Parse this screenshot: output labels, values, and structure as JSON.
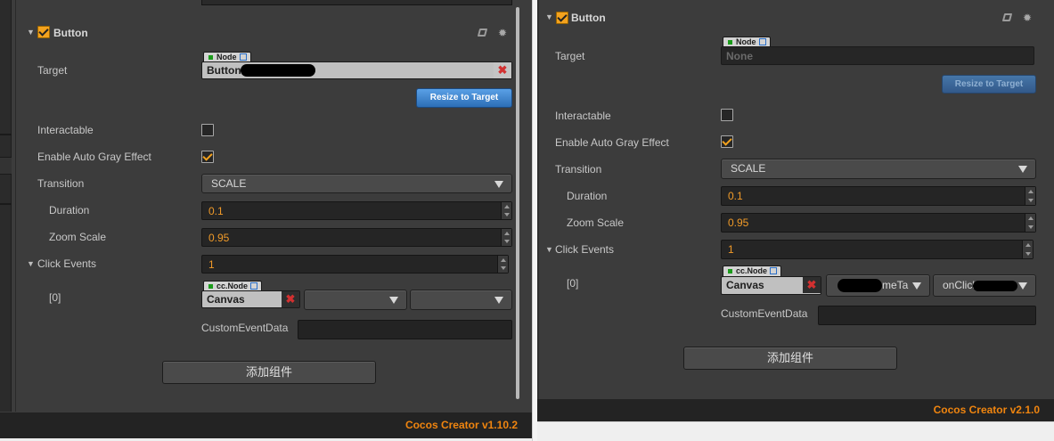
{
  "left": {
    "component_title": "Button",
    "props": {
      "target": "Target",
      "interactable": "Interactable",
      "auto_gray": "Enable Auto Gray Effect",
      "transition": "Transition",
      "duration": "Duration",
      "zoom_scale": "Zoom Scale",
      "click_events": "Click Events",
      "event_index": "[0]",
      "custom_event_data": "CustomEventData"
    },
    "target_tag": "Node",
    "target_value": "Button",
    "resize_button": "Resize to Target",
    "interactable_checked": false,
    "auto_gray_checked": true,
    "transition_value": "SCALE",
    "duration_value": "0.1",
    "zoom_scale_value": "0.95",
    "click_events_count": "1",
    "event_node_tag": "cc.Node",
    "event_node_value": "Canvas",
    "event_component": "",
    "event_handler": "",
    "add_component_button": "添加组件",
    "footer": "Cocos Creator v1.10.2"
  },
  "right": {
    "component_title": "Button",
    "props": {
      "target": "Target",
      "interactable": "Interactable",
      "auto_gray": "Enable Auto Gray Effect",
      "transition": "Transition",
      "duration": "Duration",
      "zoom_scale": "Zoom Scale",
      "click_events": "Click Events",
      "event_index": "[0]",
      "custom_event_data": "CustomEventData"
    },
    "target_tag": "Node",
    "target_value": "None",
    "resize_button": "Resize to Target",
    "interactable_checked": false,
    "auto_gray_checked": true,
    "transition_value": "SCALE",
    "duration_value": "0.1",
    "zoom_scale_value": "0.95",
    "click_events_count": "1",
    "event_node_tag": "cc.Node",
    "event_node_value": "Canvas",
    "event_component": "meTa",
    "event_handler": "onClick",
    "add_component_button": "添加组件",
    "footer": "Cocos Creator v2.1.0"
  },
  "colors": {
    "panel_bg": "#3c3c3c",
    "accent_orange": "#f0850f",
    "field_value": "#f09a28",
    "button_blue": "#2c6eb6"
  },
  "icons": [
    "checkbox-icon",
    "book-icon",
    "gear-icon",
    "link-icon",
    "remove-icon",
    "caret-down-icon"
  ]
}
